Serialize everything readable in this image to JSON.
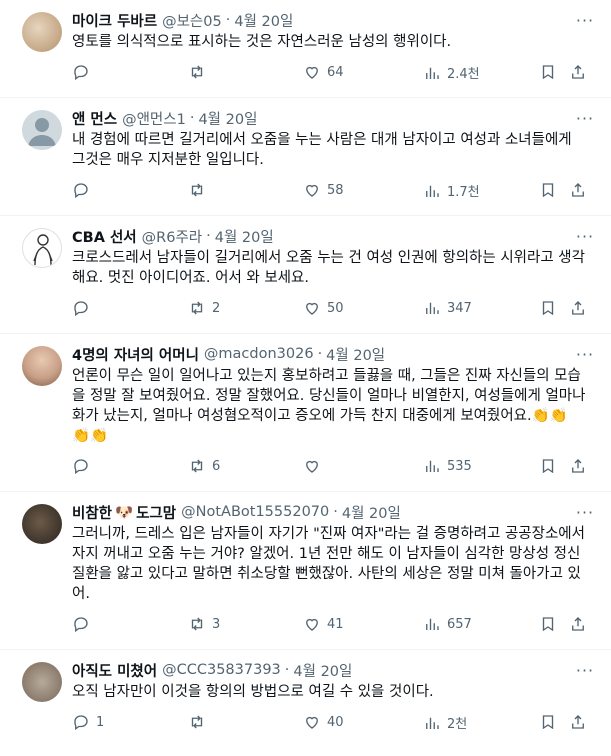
{
  "tweets": [
    {
      "name": "마이크 두바르",
      "handle": "@보슨05",
      "sep": "·",
      "date": "4월 20일",
      "text": "영토를 의식적으로 표시하는 것은 자연스러운 남성의 행위이다.",
      "replies": "",
      "retweets": "",
      "likes": "64",
      "views": "2.4천"
    },
    {
      "name": "앤 먼스",
      "handle": "@앤먼스1",
      "sep": "·",
      "date": "4월 20일",
      "text": "내 경험에 따르면 길거리에서 오줌을 누는 사람은 대개 남자이고 여성과 소녀들에게\n그것은 매우 지저분한 일입니다.",
      "replies": "",
      "retweets": "",
      "likes": "58",
      "views": "1.7천"
    },
    {
      "name": "CBA 선서",
      "handle": "@R6주라",
      "sep": "·",
      "date": "4월 20일",
      "text": "크로스드레서 남자들이 길거리에서 오줌 누는 건 여성 인권에 항의하는 시위라고 생각\n해요. 멋진 아이디어죠. 어서 와 보세요.",
      "replies": "",
      "retweets": "2",
      "likes": "50",
      "views": "347"
    },
    {
      "name": "4명의 자녀의 어머니",
      "handle": "@macdon3026",
      "sep": "·",
      "date": "4월 20일",
      "text": "언론이 무슨 일이 일어나고 있는지 홍보하려고 들끓을 때, 그들은 진짜 자신들의 모습\n을 정말 잘 보여줬어요. 정말 잘했어요. 당신들이 얼마나 비열한지, 여성들에게 얼마나\n화가 났는지, 얼마나 여성혐오적이고 증오에 가득 찬지 대중에게 보여줬어요.👏👏\n👏👏",
      "replies": "",
      "retweets": "6",
      "likes": "",
      "views": "535"
    },
    {
      "name": "비참한",
      "badge": "🐶",
      "name2": "도그맘",
      "handle": "@NotABot15552070",
      "sep": "·",
      "date": "4월 20일",
      "text": "그러니까, 드레스 입은 남자들이 자기가 \"진짜 여자\"라는 걸 증명하려고 공공장소에서\n자지 꺼내고 오줌 누는 거야? 알겠어. 1년 전만 해도 이 남자들이 심각한 망상성 정신\n질환을 앓고 있다고 말하면 취소당할 뻔했잖아. 사탄의 세상은 정말 미쳐 돌아가고 있\n어.",
      "replies": "",
      "retweets": "3",
      "likes": "41",
      "views": "657"
    },
    {
      "name": "아직도 미쳤어",
      "handle": "@CCC35837393",
      "sep": "·",
      "date": "4월 20일",
      "text": "오직 남자만이 이것을 항의의 방법으로 여길 수 있을 것이다.",
      "replies": "1",
      "retweets": "",
      "likes": "40",
      "views": "2천"
    }
  ],
  "icons": {
    "reply": "reply-icon",
    "retweet": "retweet-icon",
    "like": "heart-icon",
    "views": "views-icon",
    "bookmark": "bookmark-icon",
    "share": "share-icon",
    "more": "more-icon"
  },
  "more_glyph": "···"
}
